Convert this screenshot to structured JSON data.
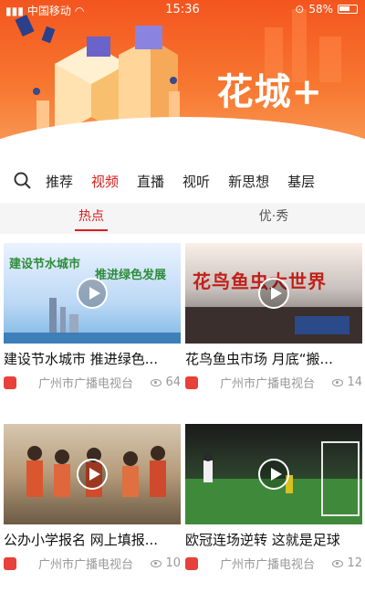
{
  "status": {
    "carrier": "中国移动",
    "time": "15:36",
    "battery": "58%"
  },
  "banner": {
    "brand": "花城+"
  },
  "nav": {
    "tabs": [
      "推荐",
      "视频",
      "直播",
      "视听",
      "新思想",
      "基层"
    ],
    "active_index": 1
  },
  "subtabs": {
    "items": [
      "热点",
      "优·秀"
    ],
    "active_index": 0
  },
  "thumbs": {
    "t1_text_a": "建设节水城市",
    "t1_text_b": "推进绿色发展",
    "t2_sign": "花鸟鱼虫大世界"
  },
  "cards": [
    {
      "title": "建设节水城市 推进绿色...",
      "source": "广州市广播电视台",
      "views": "64"
    },
    {
      "title": "花鸟鱼虫市场 月底“搬...",
      "source": "广州市广播电视台",
      "views": "14"
    },
    {
      "title": "公办小学报名 网上填报...",
      "source": "广州市广播电视台",
      "views": "10"
    },
    {
      "title": "欧冠连场逆转 这就是足球",
      "source": "广州市广播电视台",
      "views": "12"
    }
  ],
  "colors": {
    "accent": "#d81e1e",
    "banner": "#f4551f"
  }
}
